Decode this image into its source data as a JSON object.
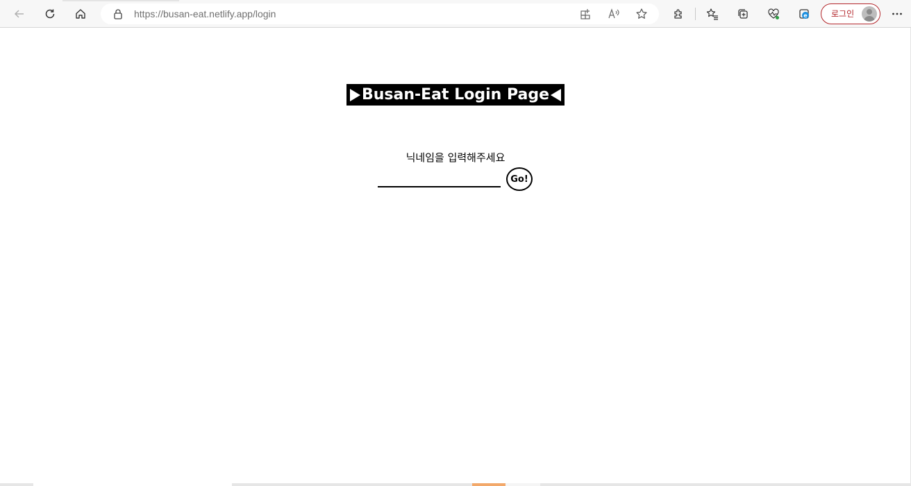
{
  "browser": {
    "url_host": "https://busan-eat.netlify.app",
    "url_path": "/login",
    "profile_label": "로그인",
    "icons": {
      "back": "back-arrow-icon",
      "reload": "reload-icon",
      "home": "home-icon",
      "lock": "lock-icon",
      "app_available": "app-available-icon",
      "read_aloud": "read-aloud-icon",
      "favorite": "star-icon",
      "extensions": "puzzle-icon",
      "favorites": "favorites-icon",
      "collections": "collections-icon",
      "performance": "heartbeat-icon",
      "ie_mode": "ie-icon",
      "menu": "more-icon",
      "avatar": "avatar-icon"
    }
  },
  "login": {
    "title": "Busan-Eat Login Page",
    "nickname_label": "닉네임을 입력해주세요",
    "nickname_value": "",
    "go_button": "Go!"
  },
  "colors": {
    "title_bg": "#000000",
    "title_fg": "#ffffff",
    "profile_accent": "#b3262b"
  }
}
